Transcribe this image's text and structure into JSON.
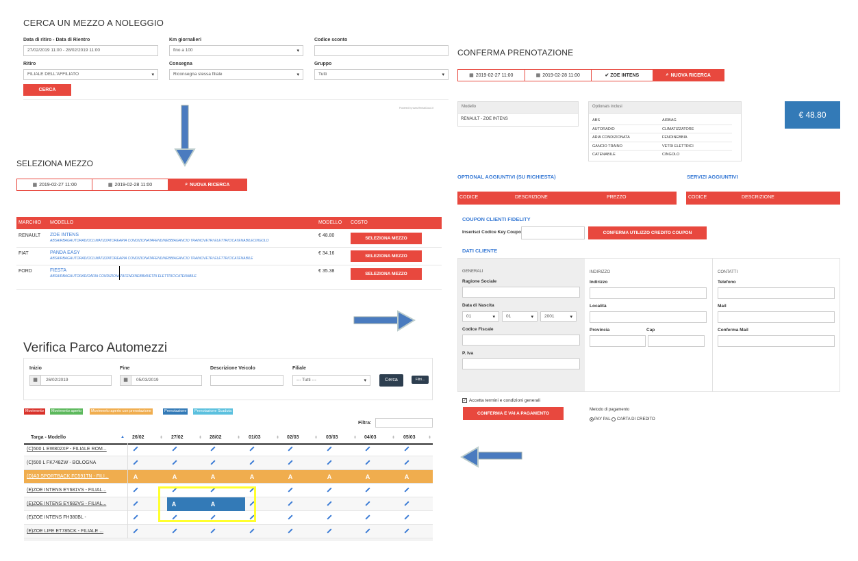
{
  "search": {
    "title": "CERCA UN MEZZO A NOLEGGIO",
    "dates_label": "Data di ritiro - Data di Rientro",
    "dates_value": "27/02/2019 11:00 - 28/02/2019 11:00",
    "km_label": "Km giornalieri",
    "km_value": "fino a 100",
    "discount_label": "Codice sconto",
    "pickup_label": "Ritiro",
    "pickup_value": "FILIALE DELL'AFFILIATO",
    "return_label": "Consegna",
    "return_value": "Riconsegna stessa filiale",
    "group_label": "Gruppo",
    "group_value": "Tutti",
    "search_button": "CERCA",
    "powered": "Powered by www.RentalCloud.it"
  },
  "select": {
    "title": "SELEZIONA MEZZO",
    "date_from": "2019-02-27 11:00",
    "date_to": "2019-02-28 11:00",
    "new_search": "NUOVA RICERCA",
    "headers": {
      "brand": "MARCHIO",
      "model": "MODELLO",
      "model2": "MODELLO",
      "cost": "COSTO"
    },
    "rows": [
      {
        "brand": "RENAULT",
        "model": "ZOE INTENS",
        "options": "ABSAIRBAGAUTORADIOCLIMATIZZATOREARIA CONDIZIONATAFENDINEBBIAGANCIO TRAINOVETRI ELETTRICICATENABILECINGOLO",
        "price": "€ 48.80",
        "button": "SELEZIONA MEZZO"
      },
      {
        "brand": "FIAT",
        "model": "PANDA EASY",
        "options": "ABSAIRBAGAUTORADIOCLIMATIZZATOREARIA CONDIZIONATAFENDINEBBIAGANCIO TRAINOVETRI ELETTRICICATENABILE",
        "price": "€ 34.16",
        "button": "SELEZIONA MEZZO"
      },
      {
        "brand": "FORD",
        "model": "FIESTA",
        "options": "ABSAIRBAGAUTORADIOARIA CONDIZIONATAFENDINEBBIAVETRI ELETTRICICATENABILE",
        "price": "€ 35.38",
        "button": "SELEZIONA MEZZO"
      }
    ]
  },
  "fleet": {
    "title": "Verifica Parco Automezzi",
    "start_label": "Inizio",
    "start_value": "26/02/2019",
    "end_label": "Fine",
    "end_value": "05/03/2019",
    "desc_label": "Descrizione Veicolo",
    "branch_label": "Filiale",
    "branch_value": "--- Tutti ---",
    "search_button": "Cerca",
    "filter_button": "Filtri...",
    "filter_label": "Filtra:",
    "legend": [
      {
        "label": "Movimento",
        "color": "#d9322b"
      },
      {
        "label": "Movimento aperto",
        "color": "#5cb85c"
      },
      {
        "label": "Movimento aperto con prenotazione",
        "color": "#f0ad4e"
      },
      {
        "label": "Prenotazione",
        "color": "#337ab7"
      },
      {
        "label": "Prenotazione Scaduta",
        "color": "#5bc0de"
      }
    ],
    "col_vehicle": "Targa - Modello",
    "days": [
      "26/02",
      "27/02",
      "28/02",
      "01/03",
      "02/03",
      "03/03",
      "04/03",
      "05/03"
    ],
    "vehicles": [
      "(C)500 L EW802XP - FILIALE ROM...",
      "(C)500 L FK748ZW - BOLOGNA",
      "(D)A3 SPORTBACK FC591TN - FILI...",
      "(E)ZOE INTENS EY681VS - FILIAL...",
      "(E)ZOE INTENS EY682VS - FILIAL...",
      "(E)ZOE INTENS FH380BL -",
      "(E)ZOE LIFE ET785CK - FILIALE ..."
    ]
  },
  "confirm": {
    "title": "CONFERMA PRENOTAZIONE",
    "date_from": "2019-02-27 11:00",
    "date_to": "2019-02-28 11:00",
    "vehicle": "ZOE INTENS",
    "new_search": "NUOVA RICERCA",
    "model_head": "Modello",
    "model_value": "RENAULT - ZOE INTENS",
    "optionals_head": "Optionals inclusi",
    "optionals": [
      [
        "ABS",
        "AIRBAG"
      ],
      [
        "AUTORADIO",
        "CLIMATIZZATORE"
      ],
      [
        "ARIA CONDIZIONATA",
        "FENDINEBBIA"
      ],
      [
        "GANCIO TRAINO",
        "VETRI ELETTRICI"
      ],
      [
        "CATENABILE",
        "CINGOLO"
      ]
    ],
    "price": "€ 48.80",
    "extra_title": "OPTIONAL AGGIUNTIVI (SU RICHIESTA)",
    "services_title": "SERVIZI AGGIUNTIVI",
    "col_code": "CODICE",
    "col_desc": "DESCRIZIONE",
    "col_price": "PREZZO",
    "coupon_title": "COUPON CLIENTI FIDELITY",
    "coupon_label": "Inserisci Codice Key Coupon",
    "coupon_button": "CONFERMA UTILIZZO CREDITO COUPON",
    "customer_title": "DATI CLIENTE",
    "general_head": "GENERALI",
    "company_label": "Ragione Sociale",
    "birth_label": "Data di Nascita",
    "birth_day": "01",
    "birth_month": "01",
    "birth_year": "2001",
    "tax_label": "Codice Fiscale",
    "vat_label": "P. Iva",
    "address_head": "INDIRIZZO",
    "address_label": "Indirizzo",
    "city_label": "Località",
    "province_label": "Provincia",
    "zip_label": "Cap",
    "contacts_head": "CONTATTI",
    "phone_label": "Telefono",
    "mail_label": "Mail",
    "confirm_mail_label": "Conferma Mail",
    "terms_label": "Accetta termini e condizioni generali",
    "pay_button": "CONFERMA E VAI A PAGAMENTO",
    "payment_label": "Metodo di pagamento",
    "pay_paypal": "PAY PAL",
    "pay_card": "CARTA DI CREDITO"
  }
}
